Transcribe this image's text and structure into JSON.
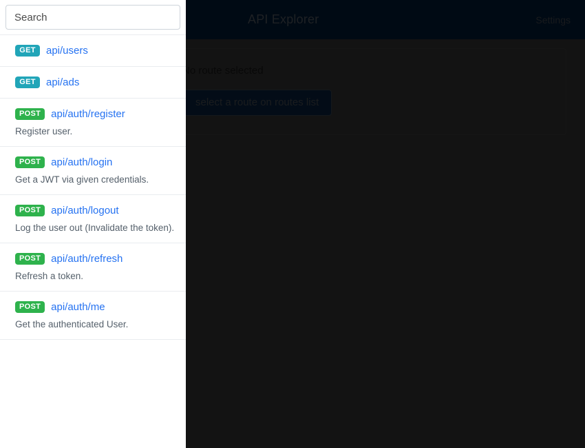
{
  "header": {
    "title": "API Explorer",
    "settings_label": "Settings"
  },
  "sidebar": {
    "search": {
      "placeholder": "Search",
      "value": ""
    },
    "routes": [
      {
        "method": "GET",
        "path": "api/users",
        "description": ""
      },
      {
        "method": "GET",
        "path": "api/ads",
        "description": ""
      },
      {
        "method": "POST",
        "path": "api/auth/register",
        "description": "Register user."
      },
      {
        "method": "POST",
        "path": "api/auth/login",
        "description": "Get a JWT via given credentials."
      },
      {
        "method": "POST",
        "path": "api/auth/logout",
        "description": "Log the user out (Invalidate the token)."
      },
      {
        "method": "POST",
        "path": "api/auth/refresh",
        "description": "Refresh a token."
      },
      {
        "method": "POST",
        "path": "api/auth/me",
        "description": "Get the authenticated User."
      }
    ]
  },
  "main": {
    "card": {
      "title": "No route selected",
      "button_label": "select a route on routes list"
    }
  },
  "colors": {
    "topbar_bg": "#012449",
    "content_bg": "#454545",
    "get_badge": "#21a5b8",
    "post_badge": "#2eb24c",
    "route_link": "#2572f1",
    "button_bg": "#0b2e55"
  }
}
